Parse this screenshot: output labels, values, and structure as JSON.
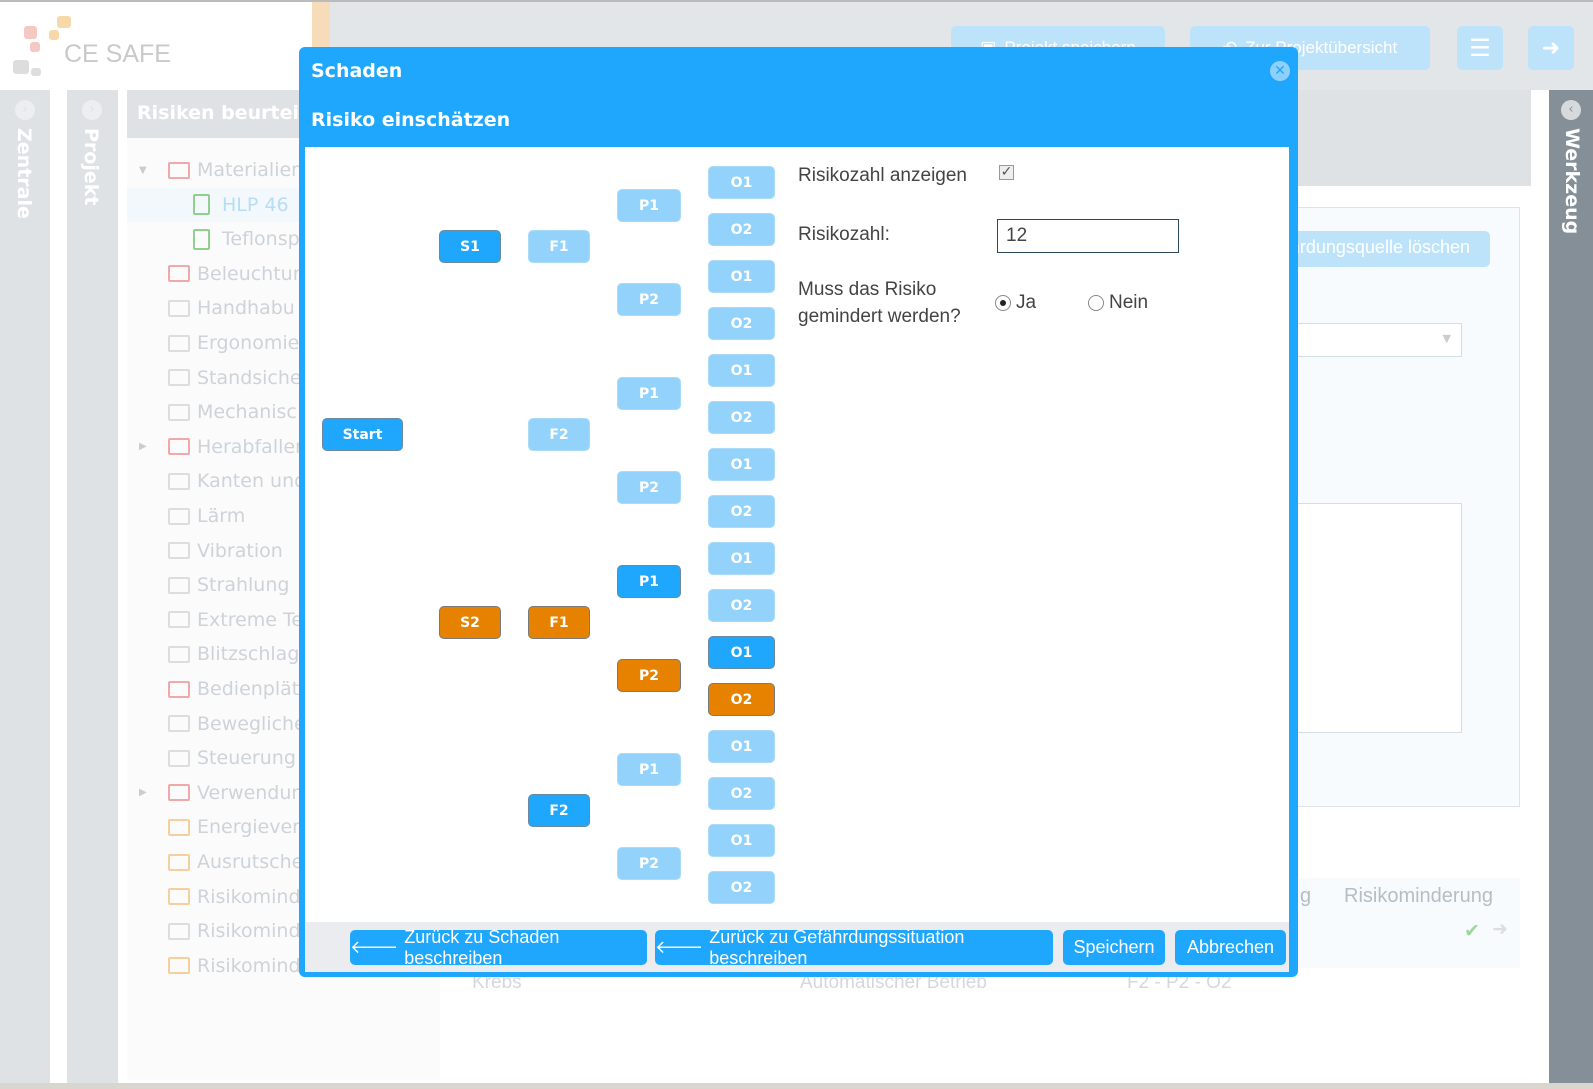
{
  "app": {
    "logo_text": "CE SAFE"
  },
  "header": {
    "save_project": "Projekt speichern",
    "project_overview": "Zur Projektübersicht",
    "menu_icon": "hamburger-icon",
    "logout_icon": "sign-out-icon"
  },
  "sidebars": {
    "left1": "Zentrale",
    "left2": "Projekt",
    "right": "Werkzeug"
  },
  "tree": {
    "title": "Risiken beurteilen",
    "items": [
      {
        "label": "Materialien",
        "icon": "folder-edit-icon",
        "color": "#f0a8a8",
        "expanded": true
      },
      {
        "label": "HLP 46",
        "icon": "file-check-icon",
        "color": "#8fd08f",
        "selected": true,
        "child": true
      },
      {
        "label": "Teflonsp",
        "icon": "file-check-icon",
        "color": "#8fd08f",
        "child": true
      },
      {
        "label": "Beleuchtun",
        "icon": "folder-edit-icon",
        "color": "#f0a8a8"
      },
      {
        "label": "Handhabu",
        "icon": "folder-x-icon",
        "color": "#ddd"
      },
      {
        "label": "Ergonomie",
        "icon": "folder-x-icon",
        "color": "#ddd"
      },
      {
        "label": "Standsiche",
        "icon": "folder-x-icon",
        "color": "#ddd"
      },
      {
        "label": "Mechanisc",
        "icon": "folder-x-icon",
        "color": "#ddd"
      },
      {
        "label": "Herabfallen",
        "icon": "folder-edit-icon",
        "color": "#f0a8a8",
        "collapsed": true
      },
      {
        "label": "Kanten und",
        "icon": "folder-x-icon",
        "color": "#ddd"
      },
      {
        "label": "Lärm",
        "icon": "folder-x-icon",
        "color": "#ddd"
      },
      {
        "label": "Vibration",
        "icon": "folder-x-icon",
        "color": "#ddd"
      },
      {
        "label": "Strahlung",
        "icon": "folder-x-icon",
        "color": "#ddd"
      },
      {
        "label": "Extreme Te",
        "icon": "folder-x-icon",
        "color": "#ddd"
      },
      {
        "label": "Blitzschlag",
        "icon": "folder-x-icon",
        "color": "#ddd"
      },
      {
        "label": "Bedienplät",
        "icon": "folder-edit-icon",
        "color": "#f0a8a8"
      },
      {
        "label": "Bewegliche",
        "icon": "folder-x-icon",
        "color": "#ddd"
      },
      {
        "label": "Steuerung",
        "icon": "folder-x-icon",
        "color": "#ddd"
      },
      {
        "label": "Verwendun",
        "icon": "folder-edit-icon",
        "color": "#f0a8a8",
        "collapsed": true
      },
      {
        "label": "Energiever",
        "icon": "folder-icon",
        "color": "#f7cf9c"
      },
      {
        "label": "Ausrutsche",
        "icon": "folder-icon",
        "color": "#f7cf9c"
      },
      {
        "label": "Risikomind",
        "icon": "folder-icon",
        "color": "#f7cf9c"
      },
      {
        "label": "Risikomind",
        "icon": "folder-x-icon",
        "color": "#ddd"
      },
      {
        "label": "Risikomind",
        "icon": "folder-icon",
        "color": "#f7cf9c"
      }
    ]
  },
  "background": {
    "delete_source": "Gefährdungsquelle löschen",
    "table_header_partial": "g",
    "table_header_reduction": "Risikominderung",
    "row": {
      "col1": "Krebs",
      "col2": "Automatischer Betrieb",
      "col3": "F2 - P2 - O2"
    }
  },
  "modal": {
    "title": "Schaden",
    "subtitle": "Risiko einschätzen",
    "tree_nodes": {
      "start": {
        "label": "Start",
        "state": "active"
      },
      "S": [
        {
          "label": "S1",
          "state": "active"
        },
        {
          "label": "S2",
          "state": "path"
        }
      ],
      "F": [
        {
          "label": "F1",
          "state": "inactive"
        },
        {
          "label": "F2",
          "state": "inactive"
        },
        {
          "label": "F1",
          "state": "path"
        },
        {
          "label": "F2",
          "state": "active"
        }
      ],
      "P": [
        {
          "label": "P1",
          "state": "inactive"
        },
        {
          "label": "P2",
          "state": "inactive"
        },
        {
          "label": "P1",
          "state": "inactive"
        },
        {
          "label": "P2",
          "state": "inactive"
        },
        {
          "label": "P1",
          "state": "active"
        },
        {
          "label": "P2",
          "state": "path"
        },
        {
          "label": "P1",
          "state": "inactive"
        },
        {
          "label": "P2",
          "state": "inactive"
        }
      ],
      "O": [
        {
          "label": "O1",
          "state": "inactive"
        },
        {
          "label": "O2",
          "state": "inactive"
        },
        {
          "label": "O1",
          "state": "inactive"
        },
        {
          "label": "O2",
          "state": "inactive"
        },
        {
          "label": "O1",
          "state": "inactive"
        },
        {
          "label": "O2",
          "state": "inactive"
        },
        {
          "label": "O1",
          "state": "inactive"
        },
        {
          "label": "O2",
          "state": "inactive"
        },
        {
          "label": "O1",
          "state": "inactive"
        },
        {
          "label": "O2",
          "state": "inactive"
        },
        {
          "label": "O1",
          "state": "active"
        },
        {
          "label": "O2",
          "state": "path"
        },
        {
          "label": "O1",
          "state": "inactive"
        },
        {
          "label": "O2",
          "state": "inactive"
        },
        {
          "label": "O1",
          "state": "inactive"
        },
        {
          "label": "O2",
          "state": "inactive"
        }
      ]
    },
    "form": {
      "show_risk_label": "Risikozahl anzeigen",
      "show_risk_checked": true,
      "risk_label": "Risikozahl:",
      "risk_value": "12",
      "reduce_label_1": "Muss das Risiko",
      "reduce_label_2": "gemindert werden?",
      "yes": "Ja",
      "no": "Nein",
      "selected": "Ja"
    },
    "footer": {
      "back_damage": "Zurück zu Schaden beschreiben",
      "back_situation": "Zurück zu Gefährdungssituation beschreiben",
      "save": "Speichern",
      "cancel": "Abbrechen"
    }
  },
  "colors": {
    "accent": "#1ea7fd",
    "inactive": "#93d3fb",
    "path": "#e68200"
  }
}
